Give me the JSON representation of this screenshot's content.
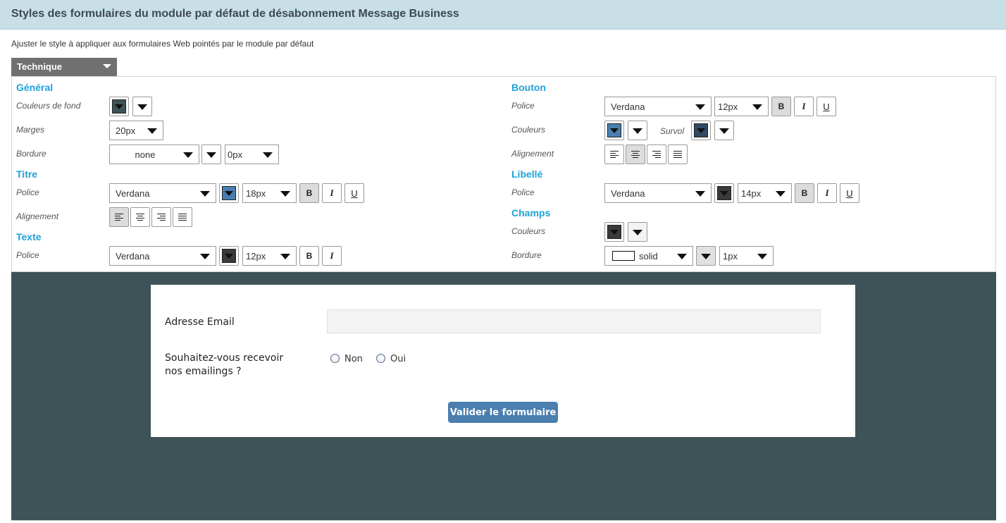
{
  "header": {
    "title": "Styles des formulaires du module par défaut de désabonnement Message Business"
  },
  "description": "Ajuster le style à appliquer aux formulaires Web pointés par le module par défaut",
  "tab": {
    "label": "Technique"
  },
  "colors": {
    "accent_section": "#1ea1d9",
    "header_bg": "#c8dfe8",
    "preview_bg": "#3e5358",
    "button_blue": "#4a7faf",
    "swatch_dark": "#3a3a3a",
    "swatch_blue": "#4a7faf",
    "swatch_navy": "#2e4a66",
    "swatch_slate": "#3e5358"
  },
  "general": {
    "title": "Général",
    "bg_colors_label": "Couleurs de fond",
    "margins_label": "Marges",
    "margins_value": "20px",
    "border_label": "Bordure",
    "border_style_value": "none",
    "border_width_value": "0px"
  },
  "titre": {
    "title": "Titre",
    "font_label": "Police",
    "font_value": "Verdana",
    "size_value": "18px",
    "bold": "B",
    "italic": "I",
    "underline": "U",
    "align_label": "Alignement"
  },
  "texte": {
    "title": "Texte",
    "font_label": "Police",
    "font_value": "Verdana",
    "size_value": "12px",
    "bold": "B",
    "italic": "I"
  },
  "bouton": {
    "title": "Bouton",
    "font_label": "Police",
    "font_value": "Verdana",
    "size_value": "12px",
    "bold": "B",
    "italic": "I",
    "underline": "U",
    "colors_label": "Couleurs",
    "hover_label": "Survol",
    "align_label": "Alignement"
  },
  "libelle": {
    "title": "Libellé",
    "font_label": "Police",
    "font_value": "Verdana",
    "size_value": "14px",
    "bold": "B",
    "italic": "I",
    "underline": "U"
  },
  "champs": {
    "title": "Champs",
    "colors_label": "Couleurs",
    "border_label": "Bordure",
    "border_style_value": "solid",
    "border_width_value": "1px"
  },
  "preview": {
    "email_label": "Adresse Email",
    "question_line1": "Souhaitez-vous recevoir",
    "question_line2": "nos emailings ?",
    "option_no": "Non",
    "option_yes": "Oui",
    "submit_label": "Valider le formulaire"
  }
}
